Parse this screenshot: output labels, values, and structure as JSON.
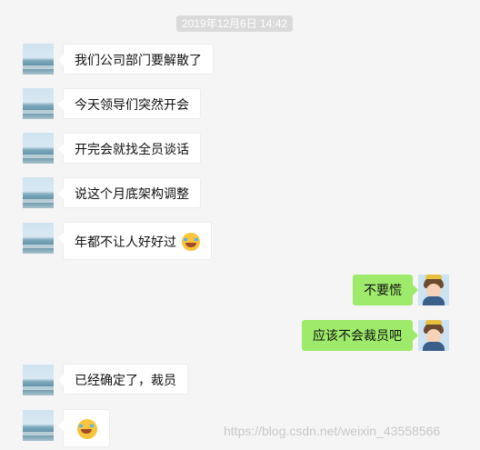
{
  "chat": {
    "timestamp": "2019年12月6日 14:42",
    "messages": [
      {
        "side": "left",
        "text": "我们公司部门要解散了"
      },
      {
        "side": "left",
        "text": "今天领导们突然开会"
      },
      {
        "side": "left",
        "text": "开完会就找全员谈话"
      },
      {
        "side": "left",
        "text": "说这个月底架构调整"
      },
      {
        "side": "left",
        "text": "年都不让人好好过",
        "emoji": "laugh-cry-emoji"
      },
      {
        "side": "right",
        "text": "不要慌"
      },
      {
        "side": "right",
        "text": "应该不会裁员吧"
      },
      {
        "side": "left",
        "text": "已经确定了，裁员"
      },
      {
        "side": "left",
        "text": "",
        "emoji": "laugh-cry-emoji"
      }
    ]
  },
  "avatars": {
    "contact": "sea-avatar",
    "self": "boy-avatar"
  },
  "colors": {
    "background": "#f5f5f5",
    "left_bubble": "#ffffff",
    "right_bubble": "#9eea6a",
    "time_badge": "#dadada"
  },
  "watermark": "https://blog.csdn.net/weixin_43558566"
}
